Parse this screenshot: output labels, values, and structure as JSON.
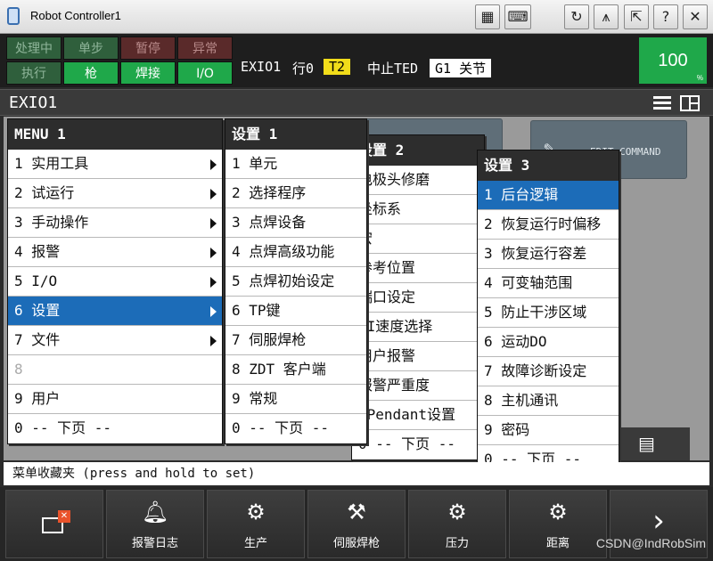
{
  "window": {
    "title": "Robot Controller1",
    "icons": [
      "teach-pendant-icon",
      "keyboard-icon",
      "reset-icon",
      "signal-icon",
      "popout-icon",
      "help-icon",
      "close-icon"
    ]
  },
  "status_leds": {
    "top": [
      "处理中",
      "单步",
      "暂停",
      "异常"
    ],
    "bottom": [
      "执行",
      "枪",
      "焊接",
      "I/O"
    ]
  },
  "status_line": {
    "program": "EXIO1",
    "line": "行0",
    "mode": "T2",
    "state": "中止TED",
    "group": "G1 关节"
  },
  "override": {
    "value": "100",
    "unit": "%"
  },
  "program_header": {
    "name": "EXIO1"
  },
  "background_tiles": [
    "EDIT COMMAND"
  ],
  "menu1": {
    "title": "MENU  1",
    "items": [
      "1 实用工具",
      "2 试运行",
      "3 手动操作",
      "4 报警",
      "5 I/O",
      "6 设置",
      "7 文件",
      "8",
      "9 用户",
      "0 -- 下页 --"
    ]
  },
  "menu2": {
    "title": "设置  1",
    "items": [
      "1 单元",
      "2 选择程序",
      "3 点焊设备",
      "4 点焊高级功能",
      "5 点焊初始设定",
      "6 TP键",
      "7 伺服焊枪",
      "8 ZDT 客户端",
      "9 常规",
      "0 -- 下页 --"
    ]
  },
  "menu3": {
    "title": "设置  2",
    "items": [
      "电极头修磨",
      "坐标系",
      "宏",
      "参考位置",
      "端口设定",
      "DI速度选择",
      "用户报警",
      "报警严重度",
      "iPendant设置",
      "0 -- 下页 --"
    ]
  },
  "menu4": {
    "title": "设置  3",
    "items": [
      "1 后台逻辑",
      "2 恢复运行时偏移",
      "3 恢复运行容差",
      "4 可变轴范围",
      "5 防止干涉区域",
      "6 运动DO",
      "7 故障诊断设定",
      "8 主机通讯",
      "9 密码",
      "0 -- 下页 --"
    ]
  },
  "favorites_bar": "菜单收藏夹 (press and hold to set)",
  "toolbar": {
    "buttons": [
      "",
      "报警日志",
      "生产",
      "伺服焊枪",
      "压力",
      "距离",
      ""
    ]
  },
  "watermark": "CSDN@IndRobSim"
}
